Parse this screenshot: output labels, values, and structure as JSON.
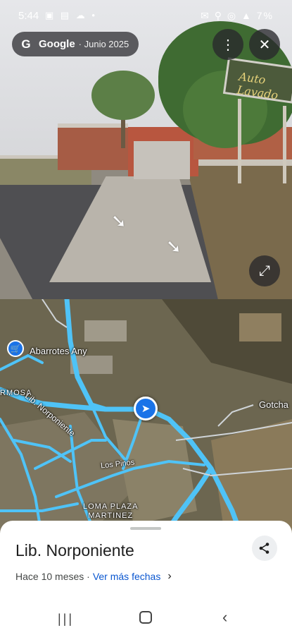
{
  "status_bar": {
    "time": "5:44",
    "left_icons": "▣ ▤ ☁ •",
    "right_icons": "✉ ⚲ ◎ ▲",
    "battery": "7%"
  },
  "streetview": {
    "brand": "Google",
    "date": "· Junio 2025",
    "sign_text": "Auto Lavado",
    "more_icon": "⋮",
    "close_icon": "✕",
    "expand_icon": "⤢"
  },
  "map": {
    "labels": {
      "shop": "Abarrotes Any",
      "hermosa": "RMOSA",
      "road_a": "Lib. Norponiente",
      "road_b": "",
      "gotcha": "Gotcha",
      "los_pinos": "Los Pinos",
      "loma_plaza": "LOMA PLAZA",
      "martinez": "MARTINEZ"
    }
  },
  "sheet": {
    "title": "Lib. Norponiente",
    "age": "Hace 10 meses ·",
    "more_dates": "Ver más fechas",
    "chevron": "›"
  },
  "nav": {
    "recent": "|||",
    "back": "‹"
  },
  "colors": {
    "accent": "#1a73e8",
    "link": "#0b57d0",
    "road": "#4fc3f7"
  }
}
